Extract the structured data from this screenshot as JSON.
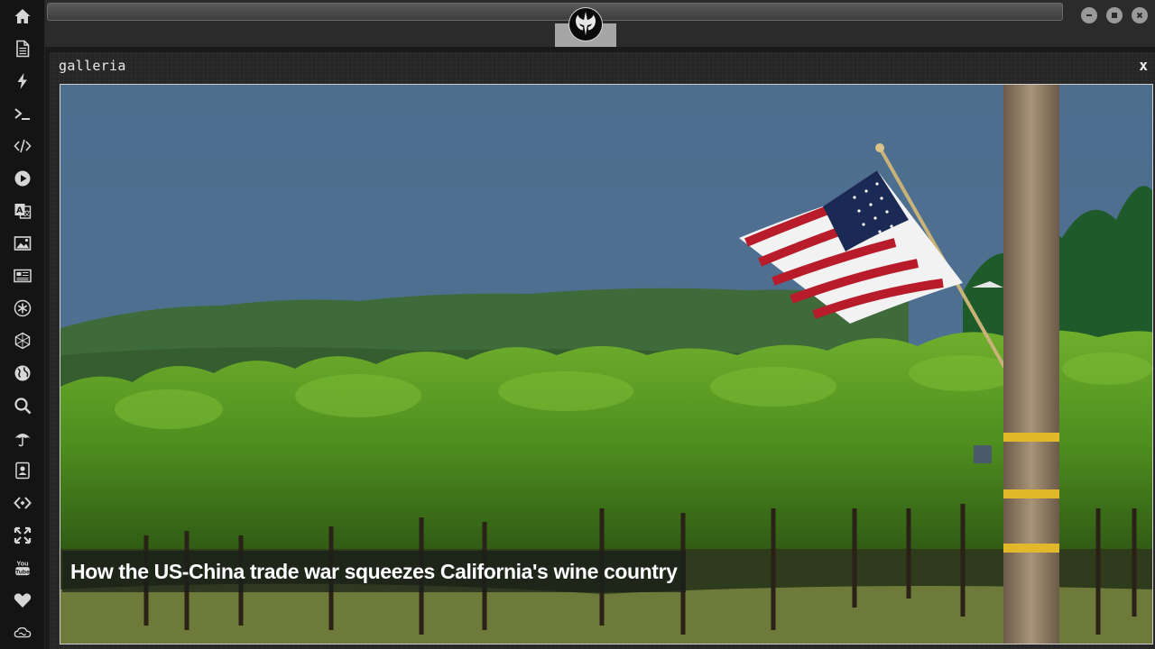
{
  "window": {
    "title": "galleria",
    "close_label": "x"
  },
  "gallery": {
    "caption": "How the US-China trade war squeezes California's wine country"
  },
  "sidebar": {
    "icons": [
      "home-icon",
      "document-icon",
      "lightning-icon",
      "terminal-icon",
      "code-icon",
      "play-icon",
      "translate-icon",
      "image-icon",
      "news-icon",
      "asterisk-icon",
      "hexagon-icon",
      "globe-icon",
      "search-icon",
      "umbrella-icon",
      "contact-card-icon",
      "tag-code-icon",
      "fullscreen-icon",
      "youtube-icon",
      "heart-icon",
      "cloud-icon"
    ]
  },
  "youtube_label": "You\nTube",
  "colors": {
    "rail_bg": "#141414",
    "icon": "#d6d6d6",
    "window_bg": "#262626",
    "topbar_bg": "#2b2b2b"
  }
}
